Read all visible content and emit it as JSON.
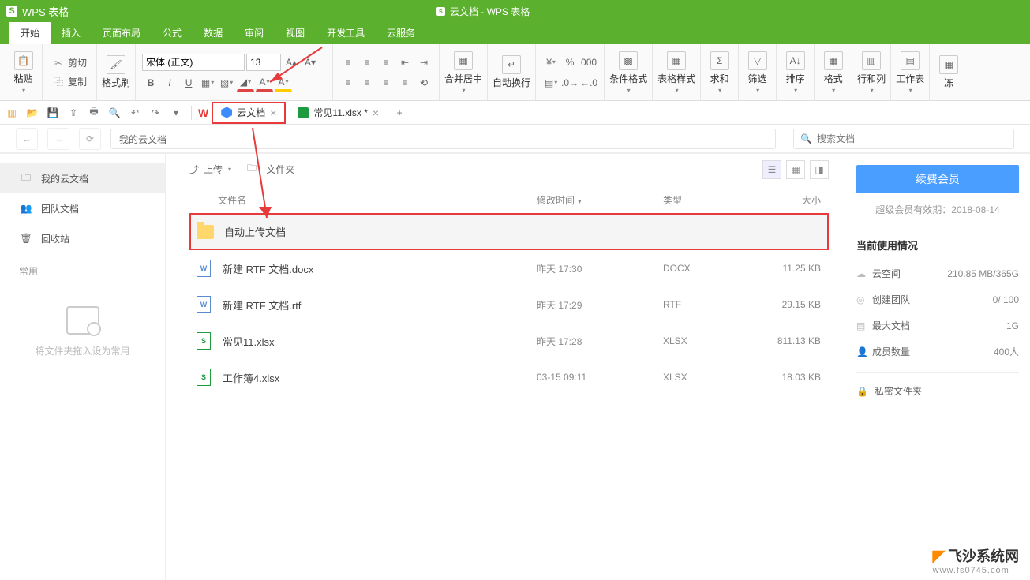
{
  "titlebar": {
    "app": "WPS 表格",
    "doc": "云文档 - WPS 表格"
  },
  "menu": [
    "开始",
    "插入",
    "页面布局",
    "公式",
    "数据",
    "审阅",
    "视图",
    "开发工具",
    "云服务"
  ],
  "ribbon": {
    "paste": "粘贴",
    "cut": "剪切",
    "copy": "复制",
    "format_painter": "格式刷",
    "font": "宋体 (正文)",
    "size": "13",
    "merge": "合并居中",
    "wrap": "自动换行",
    "cond_format": "条件格式",
    "table_style": "表格样式",
    "sum": "求和",
    "filter": "筛选",
    "sort": "排序",
    "format": "格式",
    "rowcol": "行和列",
    "sheet": "工作表",
    "freeze": "冻"
  },
  "tabs": {
    "cloud": "云文档",
    "file": "常见11.xlsx *"
  },
  "nav": {
    "path": "我的云文档",
    "search_ph": "搜索文档"
  },
  "sidebar": {
    "my": "我的云文档",
    "team": "团队文档",
    "trash": "回收站",
    "common": "常用",
    "dropzone": "将文件夹拖入设为常用"
  },
  "toolbar": {
    "upload": "上传",
    "newfolder": "文件夹"
  },
  "columns": {
    "name": "文件名",
    "time": "修改时间",
    "type": "类型",
    "size": "大小"
  },
  "files": [
    {
      "name": "自动上传文档",
      "time": "",
      "type": "",
      "size": "",
      "icon": "folder",
      "hl": true
    },
    {
      "name": "新建 RTF 文档.docx",
      "time": "昨天 17:30",
      "type": "DOCX",
      "size": "11.25 KB",
      "icon": "doc"
    },
    {
      "name": "新建 RTF 文档.rtf",
      "time": "昨天 17:29",
      "type": "RTF",
      "size": "29.15 KB",
      "icon": "doc"
    },
    {
      "name": "常见11.xlsx",
      "time": "昨天 17:28",
      "type": "XLSX",
      "size": "811.13 KB",
      "icon": "xls"
    },
    {
      "name": "工作簿4.xlsx",
      "time": "03-15 09:11",
      "type": "XLSX",
      "size": "18.03 KB",
      "icon": "xls"
    }
  ],
  "right": {
    "renew": "续费会员",
    "expiry": "超级会员有效期：2018-08-14",
    "usage_title": "当前使用情况",
    "space_l": "云空间",
    "space_v": "210.85 MB/365G",
    "team_l": "创建团队",
    "team_v": "0/ 100",
    "maxdoc_l": "最大文档",
    "maxdoc_v": "1G",
    "members_l": "成员数量",
    "members_v": "400人",
    "private": "私密文件夹"
  },
  "watermark": {
    "t1": "飞沙系统网",
    "t2": "www.fs0745.com"
  }
}
